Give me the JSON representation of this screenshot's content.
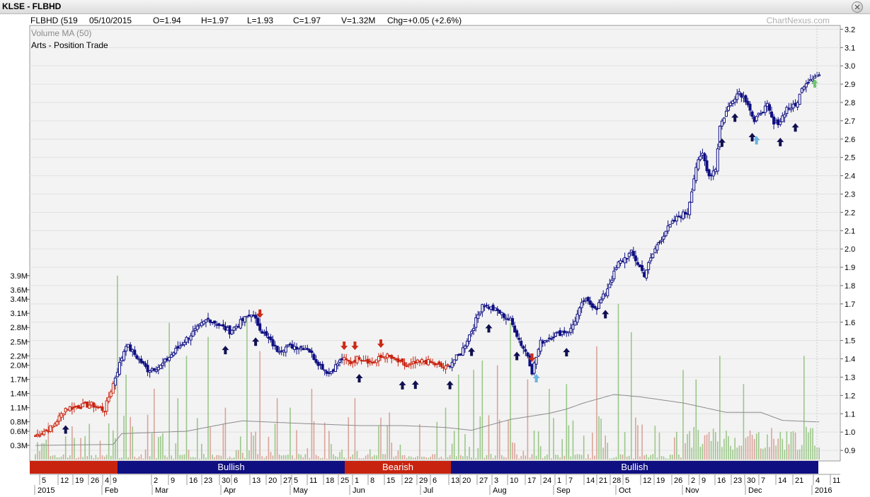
{
  "window": {
    "title": "KLSE - FLBHD"
  },
  "info": {
    "symbol": "FLBHD (519",
    "date": "05/10/2015",
    "open": "O=1.94",
    "high": "H=1.97",
    "low": "L=1.93",
    "close": "C=1.97",
    "volume": "V=1.32M",
    "change": "Chg=+0.05 (+2.6%)",
    "watermark": "ChartNexus.com",
    "legend_volume_ma": "Volume MA (50)",
    "legend_arts": "Arts - Position Trade"
  },
  "chart_data": {
    "type": "candlestick",
    "price_axis": {
      "min": 0.85,
      "max": 3.2,
      "ticks": [
        "0.9",
        "1.0",
        "1.1",
        "1.2",
        "1.3",
        "1.4",
        "1.5",
        "1.6",
        "1.7",
        "1.8",
        "1.9",
        "2.0",
        "2.1",
        "2.2",
        "2.3",
        "2.4",
        "2.5",
        "2.6",
        "2.7",
        "2.8",
        "2.9",
        "3.0",
        "3.1",
        "3.2"
      ]
    },
    "volume_axis": {
      "unit": "M",
      "ticks": [
        "0.3M",
        "0.6M",
        "0.8M",
        "1.1M",
        "1.4M",
        "1.7M",
        "2.0M",
        "2.2M",
        "2.5M",
        "2.8M",
        "3.1M",
        "3.4M",
        "3.6M",
        "3.9M"
      ]
    },
    "x_axis": {
      "day_labels": [
        "5",
        "12",
        "19",
        "26",
        "4",
        "9",
        "2",
        "9",
        "16",
        "23",
        "30",
        "6",
        "13",
        "20",
        "27",
        "5",
        "11",
        "18",
        "25",
        "1",
        "8",
        "15",
        "22",
        "29",
        "6",
        "13",
        "20",
        "27",
        "3",
        "10",
        "17",
        "24",
        "1",
        "7",
        "14",
        "21",
        "28",
        "5",
        "12",
        "19",
        "26",
        "2",
        "9",
        "16",
        "23",
        "30",
        "7",
        "14",
        "21",
        "4",
        "11"
      ],
      "month_labels": [
        "2015",
        "Feb",
        "Mar",
        "Apr",
        "May",
        "Jun",
        "Jul",
        "Aug",
        "Sep",
        "Oct",
        "Nov",
        "Dec",
        "2016"
      ]
    },
    "trend_band": [
      {
        "label": "",
        "state": "bearish",
        "color": "#c8230f"
      },
      {
        "label": "Bullish",
        "state": "bullish",
        "color": "#0f0f82"
      },
      {
        "label": "Bearish",
        "state": "bearish",
        "color": "#c8230f"
      },
      {
        "label": "Bullish",
        "state": "bullish",
        "color": "#0f0f82"
      }
    ],
    "price_key_points": [
      [
        0,
        0.98
      ],
      [
        8,
        1.03
      ],
      [
        14,
        1.13
      ],
      [
        26,
        1.15
      ],
      [
        32,
        1.12
      ],
      [
        42,
        1.48
      ],
      [
        52,
        1.34
      ],
      [
        58,
        1.36
      ],
      [
        70,
        1.51
      ],
      [
        80,
        1.62
      ],
      [
        90,
        1.55
      ],
      [
        100,
        1.65
      ],
      [
        105,
        1.55
      ],
      [
        112,
        1.45
      ],
      [
        118,
        1.47
      ],
      [
        126,
        1.46
      ],
      [
        130,
        1.39
      ],
      [
        136,
        1.32
      ],
      [
        142,
        1.4
      ],
      [
        146,
        1.38
      ],
      [
        150,
        1.41
      ],
      [
        156,
        1.38
      ],
      [
        162,
        1.42
      ],
      [
        172,
        1.36
      ],
      [
        180,
        1.39
      ],
      [
        190,
        1.35
      ],
      [
        197,
        1.43
      ],
      [
        203,
        1.58
      ],
      [
        207,
        1.7
      ],
      [
        214,
        1.66
      ],
      [
        220,
        1.61
      ],
      [
        225,
        1.48
      ],
      [
        228,
        1.42
      ],
      [
        230,
        1.33
      ],
      [
        234,
        1.49
      ],
      [
        240,
        1.53
      ],
      [
        248,
        1.56
      ],
      [
        254,
        1.72
      ],
      [
        260,
        1.68
      ],
      [
        264,
        1.76
      ],
      [
        270,
        1.92
      ],
      [
        276,
        1.98
      ],
      [
        282,
        1.86
      ],
      [
        287,
        2.0
      ],
      [
        292,
        2.1
      ],
      [
        298,
        2.18
      ],
      [
        302,
        2.2
      ],
      [
        306,
        2.45
      ],
      [
        309,
        2.52
      ],
      [
        312,
        2.4
      ],
      [
        315,
        2.44
      ],
      [
        317,
        2.67
      ],
      [
        320,
        2.75
      ],
      [
        323,
        2.82
      ],
      [
        326,
        2.86
      ],
      [
        330,
        2.8
      ],
      [
        333,
        2.69
      ],
      [
        336,
        2.75
      ],
      [
        339,
        2.78
      ],
      [
        342,
        2.68
      ],
      [
        345,
        2.7
      ],
      [
        348,
        2.77
      ],
      [
        352,
        2.78
      ],
      [
        356,
        2.9
      ],
      [
        359,
        2.93
      ],
      [
        361,
        2.95
      ]
    ],
    "volume_spikes": [
      [
        38,
        3.9
      ],
      [
        42,
        1.8
      ],
      [
        55,
        1.5
      ],
      [
        62,
        2.9
      ],
      [
        66,
        1.3
      ],
      [
        70,
        2.2
      ],
      [
        80,
        2.6
      ],
      [
        88,
        1.1
      ],
      [
        98,
        3.0
      ],
      [
        104,
        2.3
      ],
      [
        112,
        1.3
      ],
      [
        118,
        1.1
      ],
      [
        128,
        1.5
      ],
      [
        148,
        1.3
      ],
      [
        164,
        1.0
      ],
      [
        190,
        1.1
      ],
      [
        196,
        1.8
      ],
      [
        203,
        1.9
      ],
      [
        207,
        2.1
      ],
      [
        214,
        2.0
      ],
      [
        220,
        2.9
      ],
      [
        228,
        1.7
      ],
      [
        238,
        1.5
      ],
      [
        246,
        1.6
      ],
      [
        260,
        2.4
      ],
      [
        270,
        3.3
      ],
      [
        276,
        2.7
      ],
      [
        300,
        1.9
      ],
      [
        306,
        1.7
      ],
      [
        317,
        2.2
      ],
      [
        328,
        1.6
      ],
      [
        356,
        2.2
      ]
    ],
    "volume_ma_points": [
      [
        0,
        0.3
      ],
      [
        36,
        0.32
      ],
      [
        40,
        0.55
      ],
      [
        70,
        0.6
      ],
      [
        88,
        0.76
      ],
      [
        96,
        0.82
      ],
      [
        126,
        0.76
      ],
      [
        150,
        0.72
      ],
      [
        170,
        0.72
      ],
      [
        190,
        0.68
      ],
      [
        202,
        0.62
      ],
      [
        212,
        0.75
      ],
      [
        220,
        0.85
      ],
      [
        238,
        0.98
      ],
      [
        246,
        1.07
      ],
      [
        254,
        1.2
      ],
      [
        268,
        1.38
      ],
      [
        280,
        1.33
      ],
      [
        300,
        1.2
      ],
      [
        320,
        1.0
      ],
      [
        336,
        1.0
      ],
      [
        346,
        0.83
      ],
      [
        361,
        0.8
      ]
    ],
    "buy_signals": [
      [
        14,
        "dark"
      ],
      [
        88,
        "dark"
      ],
      [
        102,
        "dark"
      ],
      [
        150,
        "dark"
      ],
      [
        170,
        "dark"
      ],
      [
        176,
        "dark"
      ],
      [
        192,
        "dark"
      ],
      [
        202,
        "dark"
      ],
      [
        210,
        "dark"
      ],
      [
        223,
        "dark"
      ],
      [
        232,
        "cyan"
      ],
      [
        246,
        "dark"
      ],
      [
        264,
        "dark"
      ],
      [
        318,
        "dark"
      ],
      [
        324,
        "dark"
      ],
      [
        332,
        "dark"
      ],
      [
        334,
        "cyan"
      ],
      [
        345,
        "dark"
      ],
      [
        352,
        "dark"
      ],
      [
        361,
        "green"
      ]
    ],
    "sell_signals": [
      [
        104,
        "red"
      ],
      [
        143,
        "red"
      ],
      [
        148,
        "red"
      ],
      [
        160,
        "red"
      ],
      [
        230,
        "red"
      ]
    ]
  }
}
